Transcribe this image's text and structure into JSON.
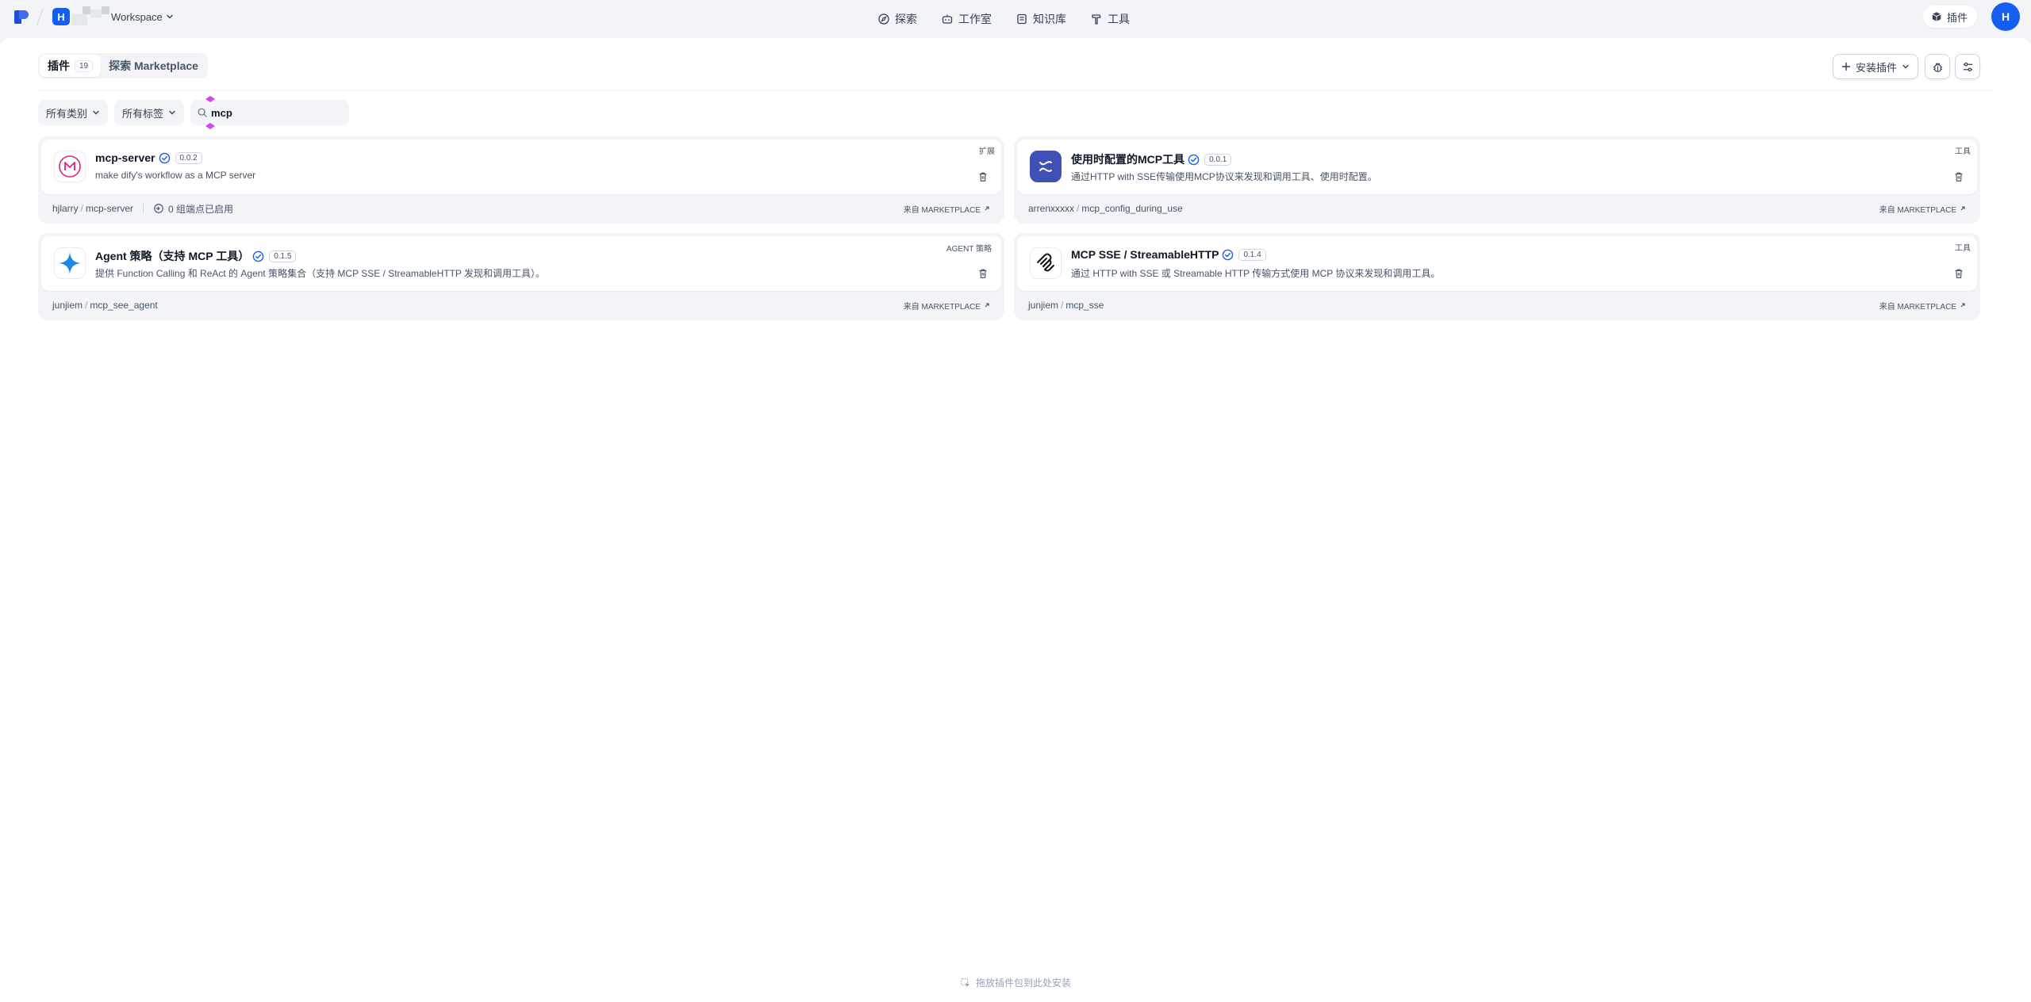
{
  "header": {
    "workspace_avatar": "H",
    "workspace_name": "Workspace",
    "nav": [
      {
        "label": "探索",
        "icon": "compass-icon"
      },
      {
        "label": "工作室",
        "icon": "robot-icon"
      },
      {
        "label": "知识库",
        "icon": "book-icon"
      },
      {
        "label": "工具",
        "icon": "hammer-icon"
      }
    ],
    "plugins_label": "插件",
    "user_avatar": "H"
  },
  "tabs": [
    {
      "label": "插件",
      "count": "19",
      "active": true
    },
    {
      "label": "探索 Marketplace",
      "active": false
    }
  ],
  "toolbar": {
    "install_label": "安装插件"
  },
  "filters": {
    "category": "所有类别",
    "tags": "所有标签",
    "search_value": "mcp"
  },
  "cards": [
    {
      "tag": "扩展",
      "title": "mcp-server",
      "version": "0.0.2",
      "description": "make dify's workflow as a MCP server",
      "author": "hjlarry",
      "repo": "mcp-server",
      "enabled_text": "0 组端点已启用",
      "market": "来自 MARKETPLACE"
    },
    {
      "tag": "工具",
      "title": "使用时配置的MCP工具",
      "version": "0.0.1",
      "description": "通过HTTP with SSE传输使用MCP协议来发现和调用工具、使用时配置。",
      "author": "arrenxxxxx",
      "repo": "mcp_config_during_use",
      "market": "来自 MARKETPLACE"
    },
    {
      "tag": "AGENT 策略",
      "title": "Agent 策略（支持 MCP 工具）",
      "version": "0.1.5",
      "description": "提供 Function Calling 和 ReAct 的 Agent 策略集合（支持 MCP SSE / StreamableHTTP 发现和调用工具）。",
      "author": "junjiem",
      "repo": "mcp_see_agent",
      "market": "来自 MARKETPLACE"
    },
    {
      "tag": "工具",
      "title": "MCP SSE / StreamableHTTP",
      "version": "0.1.4",
      "description": "通过 HTTP with SSE 或 Streamable HTTP 传输方式使用 MCP 协议来发现和调用工具。",
      "author": "junjiem",
      "repo": "mcp_sse",
      "market": "来自 MARKETPLACE"
    }
  ],
  "footer_hint": "拖放插件包到此处安装"
}
